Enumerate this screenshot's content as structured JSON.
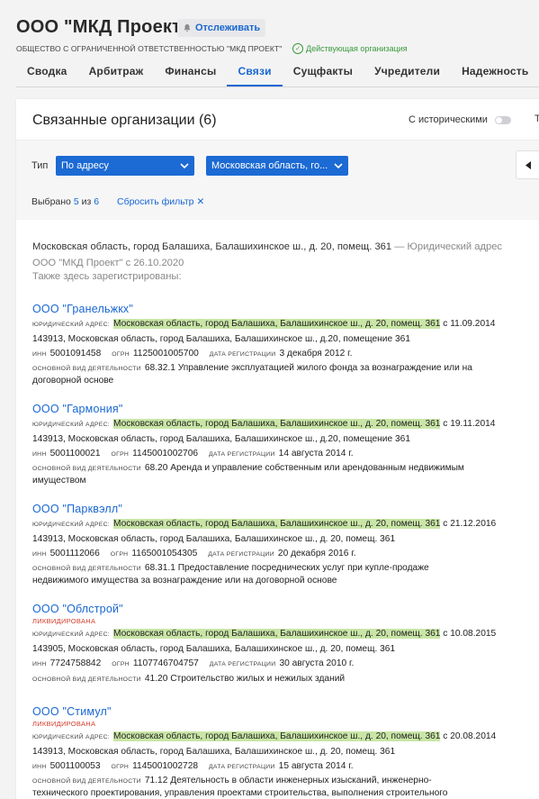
{
  "company": {
    "title": "ООО \"МКД Проект\"",
    "follow_label": "Отслеживать",
    "full_name": "ОБЩЕСТВО С ОГРАНИЧЕННОЙ ОТВЕТСТВЕННОСТЬЮ \"МКД ПРОЕКТ\"",
    "status": "Действующая организация"
  },
  "tabs": [
    "Сводка",
    "Арбитраж",
    "Финансы",
    "Связи",
    "Сущфакты",
    "Учредители",
    "Надежность"
  ],
  "active_tab": "Связи",
  "section": {
    "title": "Связанные организации (6)",
    "historic_label": "С историческими",
    "cut_label": "Т"
  },
  "filter": {
    "type_label": "Тип",
    "type_value": "По адресу",
    "region_value": "Московская область, го...",
    "selected_prefix": "Выбрано",
    "selected_count": "5",
    "selected_of": "из",
    "selected_total": "6",
    "reset_label": "Сбросить фильтр"
  },
  "address_info": {
    "address": "Московская область, город Балашиха, Балашихинское ш., д. 20, помещ. 361",
    "note": "— Юридический адрес ООО \"МКД Проект\" с 26.10.2020",
    "also": "Также здесь зарегистрированы:"
  },
  "labels": {
    "legal_address": "ЮРИДИЧЕСКИЙ АДРЕС:",
    "inn": "ИНН",
    "ogrn": "ОГРН",
    "reg_date": "ДАТА РЕГИСТРАЦИИ",
    "activity": "ОСНОВНОЙ ВИД ДЕЯТЕЛЬНОСТИ",
    "liquidated": "ЛИКВИДИРОВАНА"
  },
  "organizations": [
    {
      "name": "ООО \"Гранельжкх\"",
      "address": "Московская область, город Балашиха, Балашихинское ш., д. 20, помещ. 361",
      "since": "с 11.09.2014",
      "postal": "143913, Московская область, город Балашиха, Балашихинское ш., д.20, помещение 361",
      "inn": "5001091458",
      "ogrn": "1125001005700",
      "reg_date": "3 декабря 2012 г.",
      "activity_l1": "68.32.1 Управление эксплуатацией жилого фонда за вознаграждение или на",
      "activity_l2": "договорной основе"
    },
    {
      "name": "ООО \"Гармония\"",
      "address": "Московская область, город Балашиха, Балашихинское ш., д. 20, помещ. 361",
      "since": "с 19.11.2014",
      "postal": "143913, Московская область, город Балашиха, Балашихинское ш., д.20, помещение 361",
      "inn": "5001100021",
      "ogrn": "1145001002706",
      "reg_date": "14 августа 2014 г.",
      "activity_l1": "68.20 Аренда и управление собственным или арендованным недвижимым",
      "activity_l2": "имуществом"
    },
    {
      "name": "ООО \"Парквэлл\"",
      "address": "Московская область, город Балашиха, Балашихинское ш., д. 20, помещ. 361",
      "since": "с 21.12.2016",
      "postal": "143913, Московская область, город Балашиха, Балашихинское ш., д. 20, помещ. 361",
      "inn": "5001112066",
      "ogrn": "1165001054305",
      "reg_date": "20 декабря 2016 г.",
      "activity_l1": "68.31.1 Предоставление посреднических услуг при купле-продаже",
      "activity_l2": "недвижимого имущества за вознаграждение или на договорной основе"
    },
    {
      "name": "ООО \"Облстрой\"",
      "address": "Московская область, город Балашиха, Балашихинское ш., д. 20, помещ. 361",
      "since": "с 10.08.2015",
      "postal": "143905, Московская область, город Балашиха, Балашихинское ш., д. 20, помещ. 361",
      "inn": "7724758842",
      "ogrn": "1107746704757",
      "reg_date": "30 августа 2010 г.",
      "activity_l1": "41.20 Строительство жилых и нежилых зданий"
    },
    {
      "name": "ООО \"Стимул\"",
      "address": "Московская область, город Балашиха, Балашихинское ш., д. 20, помещ. 361",
      "since": "с 20.08.2014",
      "postal": "143913, Московская область, город Балашиха, Балашихинское ш., д. 20, помещ. 361",
      "inn": "5001100053",
      "ogrn": "1145001002728",
      "reg_date": "15 августа 2014 г.",
      "activity_l1": "71.12 Деятельность в области инженерных изысканий, инженерно-",
      "activity_l2": "технического проектирования, управления проектами строительства, выполнения строительного"
    }
  ]
}
